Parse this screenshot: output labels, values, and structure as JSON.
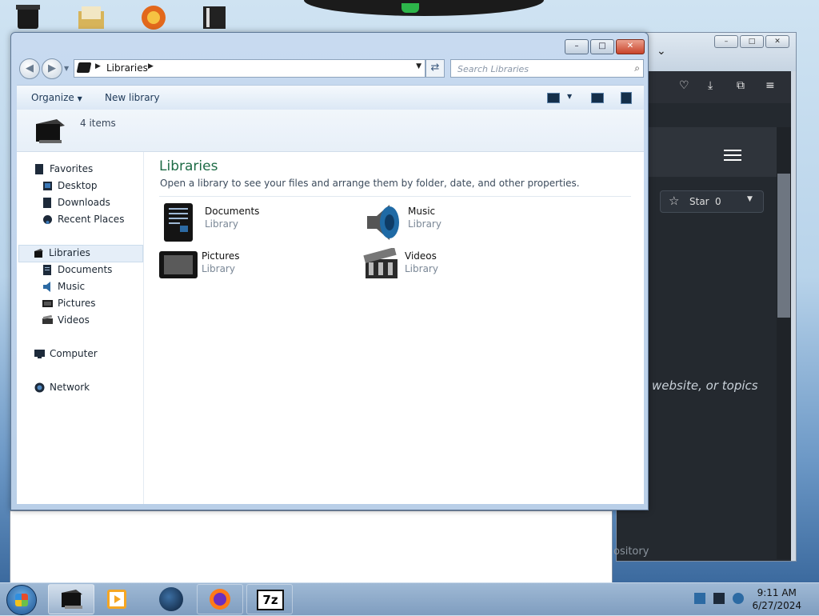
{
  "explorer": {
    "breadcrumb": "Libraries",
    "search_placeholder": "Search Libraries",
    "toolbar": {
      "organize_label": "Organize",
      "new_library_label": "New library"
    },
    "items_count": "4 items",
    "window_controls": {
      "minimize": "–",
      "maximize": "□",
      "close": "✕"
    }
  },
  "navigation": {
    "favorites": {
      "label": "Favorites",
      "items": [
        "Desktop",
        "Downloads",
        "Recent Places"
      ]
    },
    "libraries": {
      "label": "Libraries",
      "items": [
        "Documents",
        "Music",
        "Pictures",
        "Videos"
      ]
    },
    "computer": "Computer",
    "network": "Network"
  },
  "content": {
    "title": "Libraries",
    "subtitle": "Open a library to see your files and arrange them by folder, date, and other properties.",
    "libraries": [
      {
        "name": "Documents",
        "kind": "Library",
        "icon": "documents-library-icon"
      },
      {
        "name": "Music",
        "kind": "Library",
        "icon": "music-library-icon"
      },
      {
        "name": "Pictures",
        "kind": "Library",
        "icon": "pictures-library-icon"
      },
      {
        "name": "Videos",
        "kind": "Library",
        "icon": "videos-library-icon"
      }
    ]
  },
  "background_browser": {
    "star_label": "Star",
    "star_count": "0",
    "partial_text": "website, or topics",
    "partial_text_2": "ository"
  },
  "taskbar": {
    "time": "9:11 AM",
    "date": "6/27/2024",
    "apps": [
      "windows-explorer-icon",
      "media-player-icon",
      "globe-icon",
      "firefox-icon",
      "7zip-icon"
    ],
    "sevenzip_label": "7z"
  },
  "colors": {
    "title_green": "#1d6b45",
    "accent_blue": "#3d5b80",
    "close_red": "#c8432a"
  }
}
